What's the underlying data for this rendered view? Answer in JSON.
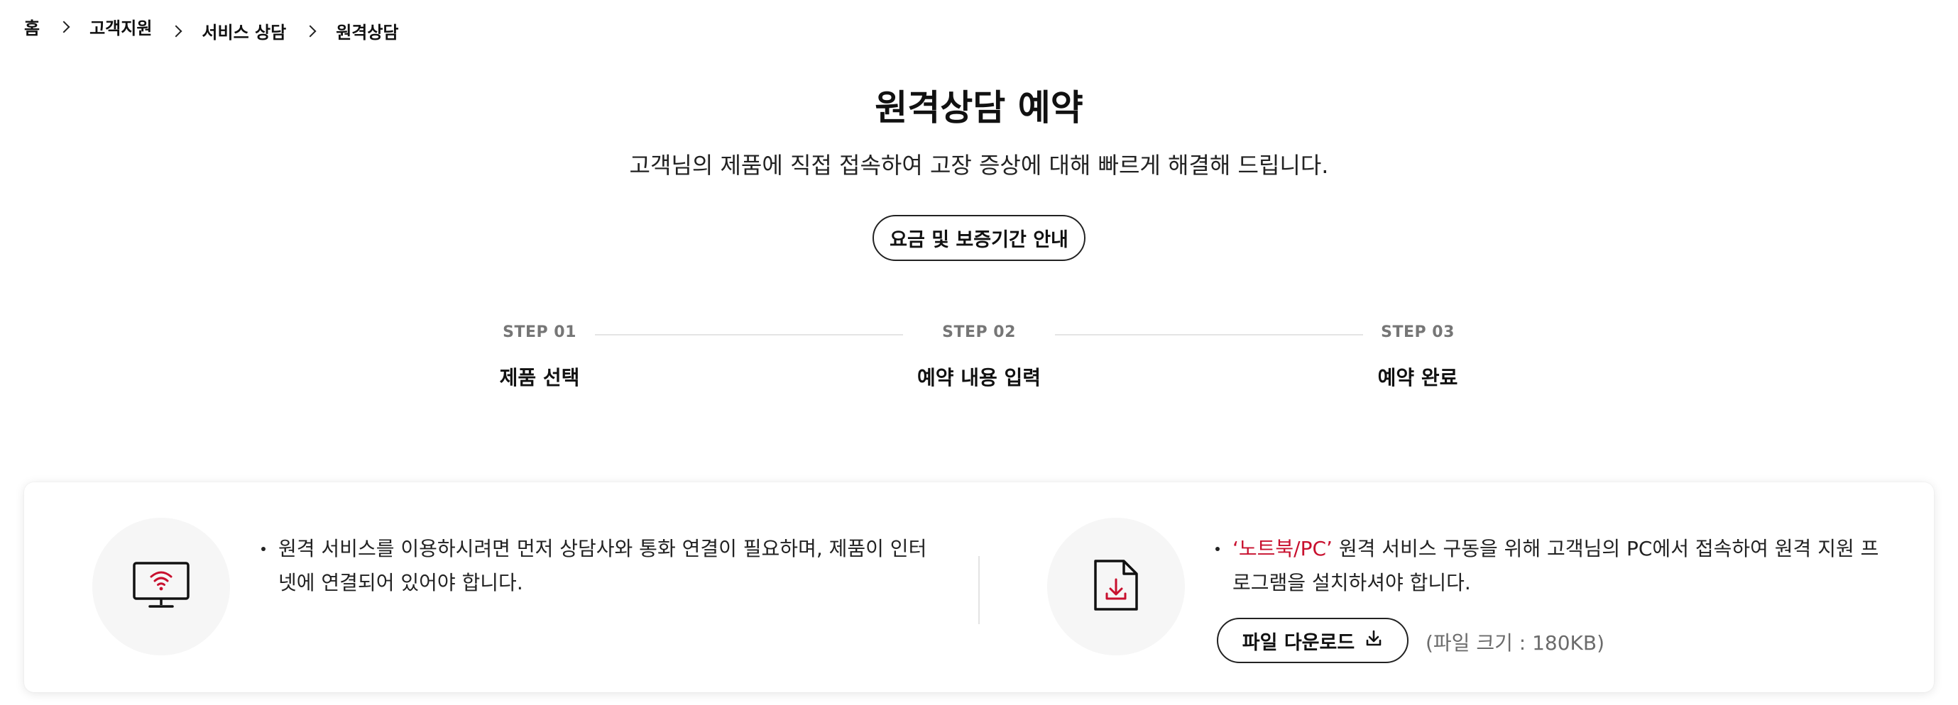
{
  "breadcrumb": {
    "items": [
      "홈",
      "고객지원",
      "서비스 상담",
      "원격상담"
    ]
  },
  "page": {
    "title": "원격상담 예약",
    "subtitle": "고객님의 제품에 직접 접속하여 고장 증상에 대해 빠르게 해결해 드립니다.",
    "fee_button": "요금 및 보증기간 안내"
  },
  "steps": [
    {
      "num": "STEP 01",
      "label": "제품 선택"
    },
    {
      "num": "STEP 02",
      "label": "예약 내용 입력"
    },
    {
      "num": "STEP 03",
      "label": "예약 완료"
    }
  ],
  "notice": {
    "left": {
      "icon": "monitor-wifi-icon",
      "text": "원격 서비스를 이용하시려면 먼저 상담사와 통화 연결이 필요하며, 제품이 인터넷에 연결되어 있어야 합니다."
    },
    "right": {
      "icon": "file-download-icon",
      "highlight": "‘노트북/PC’",
      "text": " 원격 서비스 구동을 위해 고객님의 PC에서 접속하여 원격 지원 프로그램을 설치하셔야 합니다.",
      "download_button": "파일 다운로드",
      "file_size": "(파일 크기 : 180KB)"
    }
  },
  "colors": {
    "accent": "#c8102e",
    "icon_circle_bg": "#f6f6f6",
    "step_number": "#767676"
  }
}
